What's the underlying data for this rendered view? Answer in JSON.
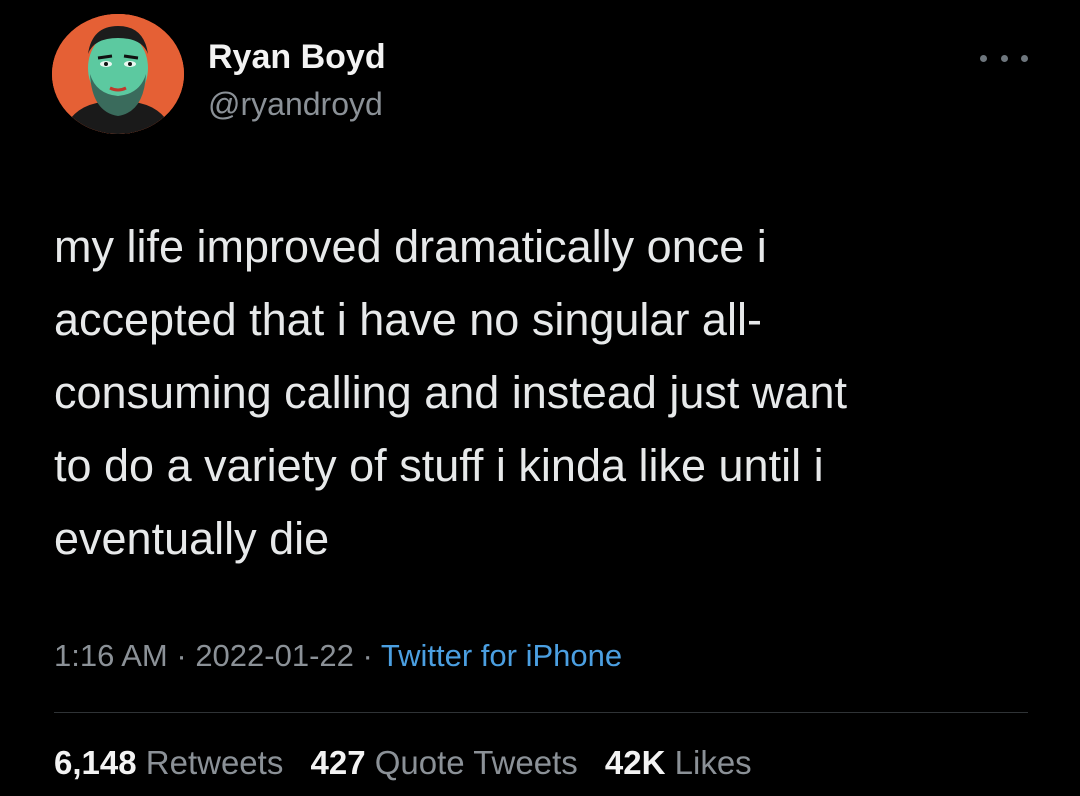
{
  "user": {
    "name": "Ryan Boyd",
    "handle": "@ryandroyd",
    "avatar_icon": "illustrated-portrait-avatar"
  },
  "tweet": {
    "text": "my life improved dramatically once i\naccepted that i have no singular all-\nconsuming calling and instead just want\nto do a variety of stuff i kinda like until i\neventually die",
    "time": "1:16 AM",
    "separator": " · ",
    "date": "2022-01-22",
    "source": "Twitter for iPhone"
  },
  "stats": {
    "retweets_count": "6,148",
    "retweets_label": "Retweets",
    "quotes_count": "427",
    "quotes_label": "Quote Tweets",
    "likes_count": "42K",
    "likes_label": "Likes"
  },
  "colors": {
    "background": "#000000",
    "text": "#e7e9ea",
    "muted": "#8b9197",
    "link": "#4b9fe1",
    "avatar_bg": "#e8643a",
    "avatar_skin": "#5cc9a0"
  },
  "menu_icon": "more-horizontal-icon"
}
